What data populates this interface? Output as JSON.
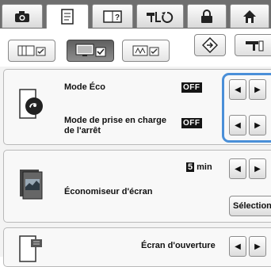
{
  "tabs": [
    {
      "icon": "camera-icon"
    },
    {
      "icon": "document-icon"
    },
    {
      "icon": "help-book-icon"
    },
    {
      "icon": "sewing-mode-icon"
    },
    {
      "icon": "lock-icon"
    },
    {
      "icon": "home-icon"
    }
  ],
  "subtabs": [
    {
      "icon": "machine-settings-icon"
    },
    {
      "icon": "general-settings-icon"
    },
    {
      "icon": "embroidery-settings-icon"
    }
  ],
  "toolbar": {
    "reset_icon": "reset-diamond-icon",
    "machine_icon": "machine-icon"
  },
  "eco": {
    "mode_eco_label": "Mode Éco",
    "mode_eco_value": "OFF",
    "shutdown_label_line1": "Mode de prise en charge",
    "shutdown_label_line2": "de l'arrêt",
    "shutdown_value": "OFF"
  },
  "screensaver": {
    "time_value": "5",
    "time_unit": "min",
    "label": "Économiseur d'écran",
    "select_label": "Sélection"
  },
  "opening": {
    "label": "Écran d'ouverture"
  },
  "arrows": {
    "left": "◀",
    "right": "▶"
  },
  "colors": {
    "highlight": "#4a8fd8",
    "tabbar": "#6f6f6f"
  }
}
